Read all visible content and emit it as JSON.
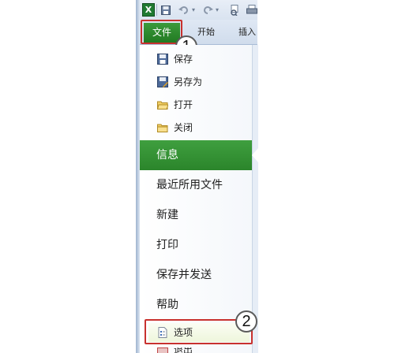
{
  "titlebar": {
    "app_icon_letter": "X",
    "qat_icons": [
      "save-icon",
      "undo-icon",
      "redo-icon",
      "print-preview-icon"
    ]
  },
  "ribbon": {
    "file_tab": "文件",
    "tabs": [
      "开始",
      "插入"
    ],
    "accent": "#2f8f2f"
  },
  "callouts": [
    "1",
    "2"
  ],
  "file_menu": {
    "commands": [
      {
        "label": "保存",
        "icon": "save-icon"
      },
      {
        "label": "另存为",
        "icon": "save-as-icon"
      },
      {
        "label": "打开",
        "icon": "open-folder-icon"
      },
      {
        "label": "关闭",
        "icon": "close-folder-icon"
      }
    ],
    "selected_section": "信息",
    "sections": [
      "最近所用文件",
      "新建",
      "打印",
      "保存并发送",
      "帮助"
    ],
    "options": {
      "label": "选项",
      "icon": "options-page-icon"
    },
    "exit": {
      "label": "退出",
      "icon": "exit-icon"
    },
    "highlight_color": "#c8312e"
  }
}
